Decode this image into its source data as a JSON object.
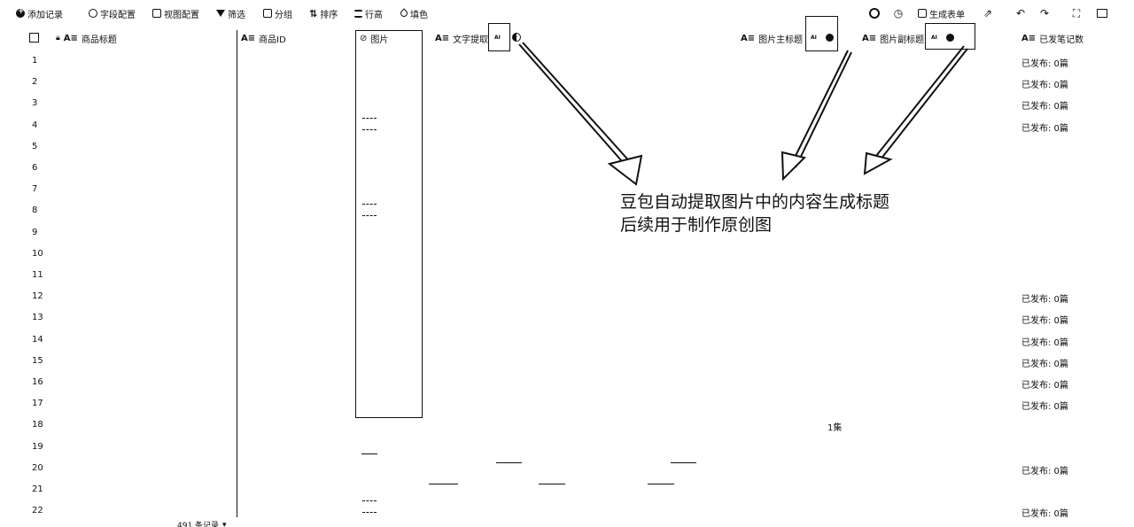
{
  "toolbar": {
    "add_record": "添加记录",
    "field_config": "字段配置",
    "view_config": "视图配置",
    "filter": "筛选",
    "group": "分组",
    "sort": "排序",
    "row_height": "行高",
    "fill_color": "填色",
    "generate_form": "生成表单"
  },
  "columns": {
    "title": "商品标题",
    "product_id": "商品ID",
    "image": "图片",
    "text_extract": "文字提取",
    "main_title": "图片主标题",
    "sub_title": "图片副标题",
    "published": "已发笔记数",
    "ai_badge": "AI"
  },
  "rows": [
    "1",
    "2",
    "3",
    "4",
    "5",
    "6",
    "7",
    "8",
    "9",
    "10",
    "11",
    "12",
    "13",
    "14",
    "15",
    "16",
    "17",
    "18",
    "19",
    "20",
    "21",
    "22"
  ],
  "published_value": "已发布: 0篇",
  "published_rows": [
    1,
    2,
    3,
    4,
    12,
    13,
    14,
    15,
    16,
    17,
    20,
    22
  ],
  "annotation": {
    "line1": "豆包自动提取图片中的内容生成标题",
    "line2": "后续用于制作原创图"
  },
  "footer": {
    "record_count": "491 条记录"
  },
  "misc": {
    "cell_fragment_18": "1集"
  }
}
